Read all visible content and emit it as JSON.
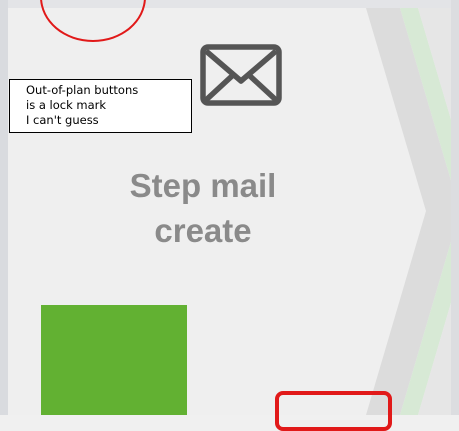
{
  "step": {
    "icon": "mail-envelope-icon",
    "title_line1": "Step mail",
    "title_line2": "create"
  },
  "note": {
    "line1": "Out-of-plan buttons",
    "line2": "is a lock mark",
    "line3": "I can't guess"
  },
  "colors": {
    "panel_background": "#efefef",
    "title_text": "#8a8a8a",
    "green_button": "#62b132",
    "annotation_red": "#e11919",
    "chevron_gray": "#dcdcdc",
    "chevron_green": "#d7e9d5"
  }
}
